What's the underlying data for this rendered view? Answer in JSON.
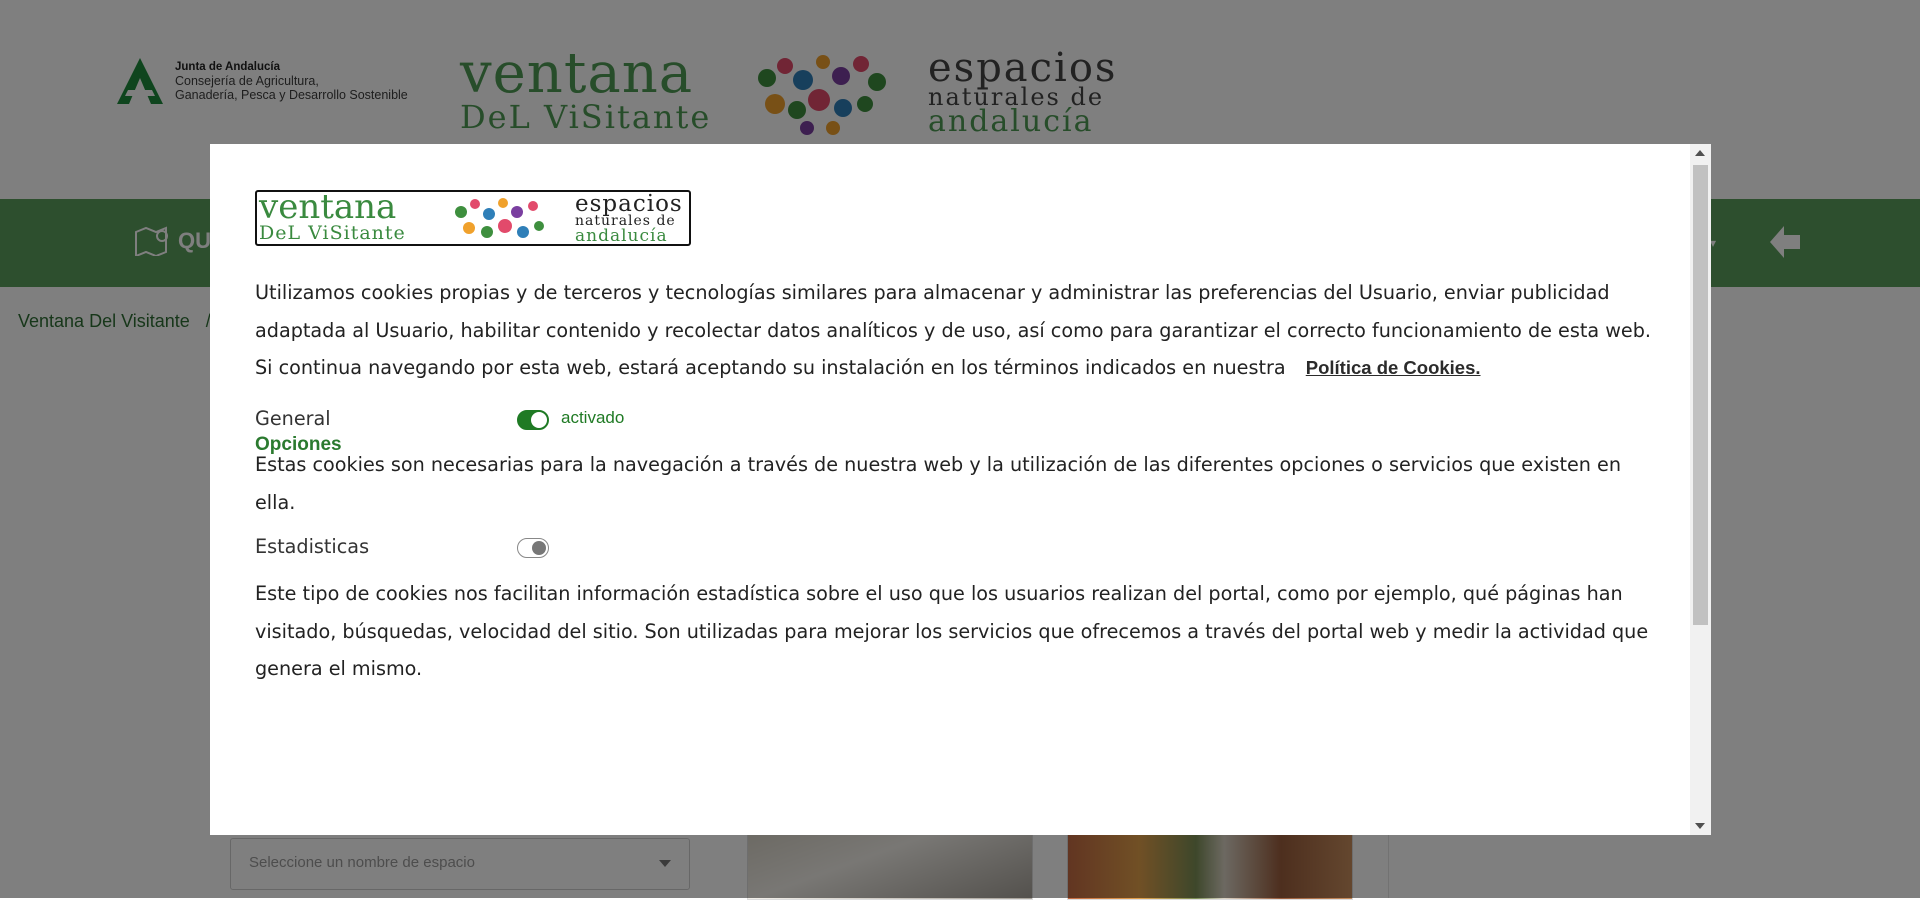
{
  "header": {
    "junta": {
      "title": "Junta de Andalucía",
      "line1": "Consejería de Agricultura,",
      "line2": "Ganadería, Pesca y Desarrollo Sostenible"
    },
    "ventana_line1": "ventana",
    "ventana_line2": "DeL ViSitante",
    "espacios_line1": "espacios",
    "espacios_line2": "naturales de",
    "espacios_line3": "andalucía"
  },
  "nav": {
    "left_item_label": "QU"
  },
  "breadcrumb": {
    "home": "Ventana Del Visitante",
    "sep": "/"
  },
  "search": {
    "space_placeholder": "Seleccione un nombre de espacio"
  },
  "modal": {
    "logo": {
      "ventana_line1": "ventana",
      "ventana_line2": "DeL ViSitante",
      "espacios_line1": "espacios",
      "espacios_line2": "naturales de",
      "espacios_line3": "andalucía"
    },
    "intro_text": "Utilizamos cookies propias y de terceros y tecnologías similares para almacenar y administrar las preferencias del Usuario, enviar publicidad adaptada al Usuario, habilitar contenido y recolectar datos analíticos y de uso, así como para garantizar el correcto funcionamiento de esta web. Si continua navegando por esta web, estará aceptando su instalación en los términos indicados en nuestra",
    "policy_link": "Política de Cookies.",
    "options_title": "Opciones",
    "options": [
      {
        "label": "General",
        "enabled": true,
        "state_text": "activado",
        "description": "Estas cookies son necesarias para la navegación a través de nuestra web y la utilización de las diferentes opciones o servicios que existen en ella."
      },
      {
        "label": "Estadisticas",
        "enabled": false,
        "state_text": "",
        "description": "Este tipo de cookies nos facilitan información estadística sobre el uso que los usuarios realizan del portal, como por ejemplo, qué páginas han visitado, búsquedas, velocidad del sitio. Son utilizadas para mejorar los servicios que ofrecemos a través del portal web y medir la actividad que genera el mismo."
      }
    ]
  },
  "colors": {
    "brand_green": "#5a9e5d",
    "accent_green": "#1f7a24",
    "overlay": "rgba(0,0,0,0.5)"
  }
}
